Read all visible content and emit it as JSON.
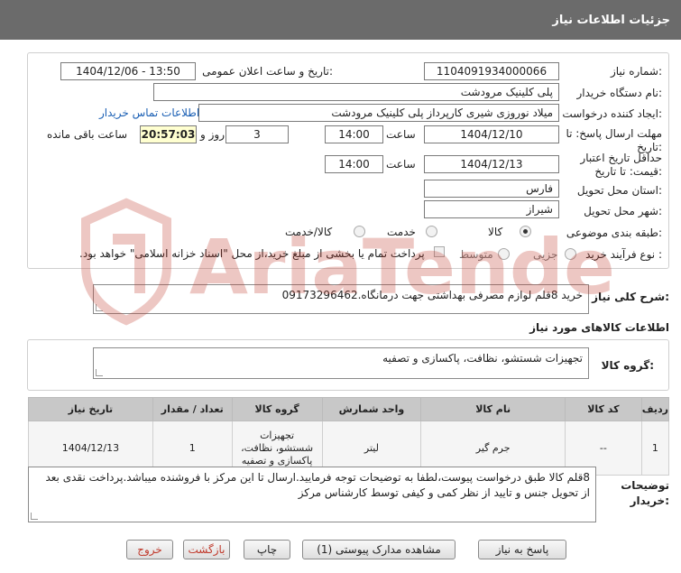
{
  "header": {
    "title": "جزئیات اطلاعات نیاز"
  },
  "form": {
    "need_number_label": "شماره نیاز:",
    "need_number": "1104091934000066",
    "announce_label": "تاریخ و ساعت اعلان عمومی:",
    "announce_value": "1404/12/06 - 13:50",
    "buyer_org_label": "نام دستگاه خریدار:",
    "buyer_org": "پلی کلینیک مرودشت",
    "creator_label": "ایجاد کننده درخواست:",
    "creator": "میلاد نوروزی شیری کارپرداز پلی کلینیک مرودشت",
    "contact_link": "اطلاعات تماس خریدار",
    "deadline_label_1": "مهلت ارسال پاسخ: تا",
    "deadline_label_2": "تاریخ:",
    "deadline_date": "1404/12/10",
    "time_label": "ساعت",
    "deadline_time": "14:00",
    "days_value": "3",
    "days_label": "روز و",
    "remaining_time": "20:57:03",
    "remaining_label": "ساعت باقی مانده",
    "validity_label_1": "حداقل تاریخ اعتبار",
    "validity_label_2": "قیمت: تا تاریخ:",
    "validity_date": "1404/12/13",
    "validity_time": "14:00",
    "province_label": "استان محل تحویل:",
    "province": "فارس",
    "city_label": "شهر محل تحویل:",
    "city": "شیراز",
    "category_label": "طبقه بندی موضوعی:",
    "category_options": [
      "کالا",
      "خدمت",
      "کالا/خدمت"
    ],
    "process_label": "نوع فرآیند خرید :",
    "process_options": [
      "جزیی",
      "متوسط"
    ],
    "payment_note": "پرداخت تمام یا بخشی از مبلغ خرید،از محل \"اسناد خزانه اسلامی\" خواهد بود."
  },
  "summary": {
    "label": "شرح کلی نیاز:",
    "text": "خرید 8قلم لوازم مصرفی بهداشتی جهت درمانگاه.09173296462"
  },
  "goods": {
    "section_title": "اطلاعات کالاهای مورد نیاز",
    "group_label": "گروه کالا:",
    "group_value": "تجهیزات شستشو، نظافت، پاکسازی و تصفیه",
    "table": {
      "headers": [
        "ردیف",
        "کد کالا",
        "نام کالا",
        "واحد شمارش",
        "گروه کالا",
        "تعداد / مقدار",
        "تاریخ نیاز"
      ],
      "rows": [
        [
          "1",
          "--",
          "جرم گیر",
          "لیتر",
          "تجهیزات شستشو، نظافت، پاکسازی و تصفیه",
          "1",
          "1404/12/13"
        ]
      ]
    }
  },
  "buyer_notes": {
    "label_1": "توضیحات",
    "label_2": "خریدار:",
    "text": "8قلم کالا طبق درخواست پیوست،لطفا به توضیحات توجه فرمایید.ارسال تا این مرکز با فروشنده میباشد.پرداخت نقدی بعد از تحویل جنس و تایید از نظر کمی و کیفی توسط کارشناس مرکز"
  },
  "buttons": {
    "reply": "پاسخ به نیاز",
    "attachments": "مشاهده مدارک پیوستی (1)",
    "print": "چاپ",
    "back": "بازگشت",
    "exit": "خروج"
  },
  "watermark": {
    "text": "AriaTender.neT"
  },
  "colors": {
    "header_bg": "#6b6b6b",
    "link": "#1a5fb4",
    "timer_bg": "#ffffd0",
    "watermark": "#c0392b"
  }
}
